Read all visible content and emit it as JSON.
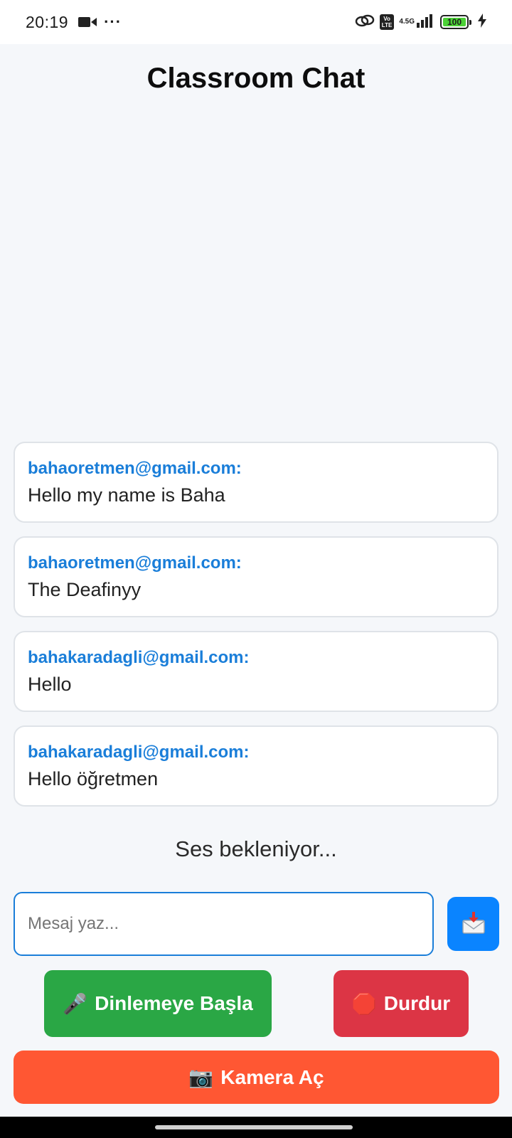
{
  "status_bar": {
    "time": "20:19",
    "network_type": "4.5G",
    "volte_label": "Vo\nLTE",
    "battery_level": "100",
    "icons": [
      "video-camera-icon",
      "more-dots-icon",
      "link-icon",
      "volte-icon",
      "signal-icon",
      "battery-icon",
      "charging-icon"
    ]
  },
  "app": {
    "title": "Classroom Chat"
  },
  "messages": [
    {
      "sender": "bahaoretmen@gmail.com:",
      "text": "Hello my name is Baha"
    },
    {
      "sender": "bahaoretmen@gmail.com:",
      "text": "The Deafinyy"
    },
    {
      "sender": "bahakaradagli@gmail.com:",
      "text": "Hello"
    },
    {
      "sender": "bahakaradagli@gmail.com:",
      "text": "Hello öğretmen"
    }
  ],
  "listening_status": "Ses bekleniyor...",
  "composer": {
    "placeholder": "Mesaj yaz...",
    "value": "",
    "send_icon": "envelope-with-arrow-icon"
  },
  "actions": {
    "listen_icon": "🎤",
    "listen_label": "Dinlemeye Başla",
    "stop_icon": "🛑",
    "stop_label": "Durdur",
    "camera_icon": "📷",
    "camera_label": "Kamera Aç"
  },
  "colors": {
    "accent_blue": "#1a7ed9",
    "send_blue": "#0a84ff",
    "listen_green": "#2aa745",
    "stop_red": "#dc3545",
    "camera_orange": "#ff5733",
    "background": "#f5f7fa"
  }
}
